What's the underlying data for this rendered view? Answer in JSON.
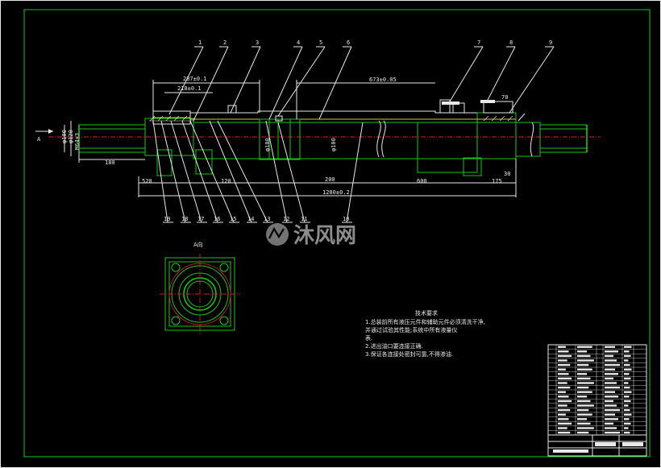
{
  "drawing": {
    "view_label": "A",
    "view_title": "A向",
    "dimensions": {
      "d287": "287±0.1",
      "d218": "218±0.1",
      "d673": "673±0.05",
      "d180": "180",
      "d200": "200",
      "d600": "600",
      "d1280": "1280±0.2",
      "d520": "520",
      "d120": "120",
      "d175": "175",
      "d30": "30",
      "dia100": "φ100",
      "dia120": "φ120",
      "dia130": "φ130",
      "m64": "M64×3",
      "dia_a": "φ100",
      "dia_b": "φ100",
      "d70": "70"
    },
    "callouts_top": [
      "1",
      "2",
      "3",
      "4",
      "5",
      "6",
      "7",
      "8",
      "9"
    ],
    "callouts_bottom": [
      "19",
      "18",
      "17",
      "16",
      "15",
      "14",
      "13",
      "12",
      "11",
      "10"
    ]
  },
  "tech_requirements": {
    "title": "技术要求",
    "lines": [
      "1.总装前所有液压元件和辅助元件必须清洗干净,",
      "  并通过试验其性能;系统中所有液量仪",
      "表.",
      "2.进出油口要连接正确.",
      "3.保证各连接处密封可靠,不得渗油."
    ]
  },
  "watermark": {
    "text": "沐风网"
  },
  "colors": {
    "background": "#000000",
    "frame": "#19c619",
    "lines": "#e8e8e8",
    "accent_yellow": "#d8c820",
    "accent_red": "#d82020",
    "accent_cyan": "#20c8c8"
  }
}
